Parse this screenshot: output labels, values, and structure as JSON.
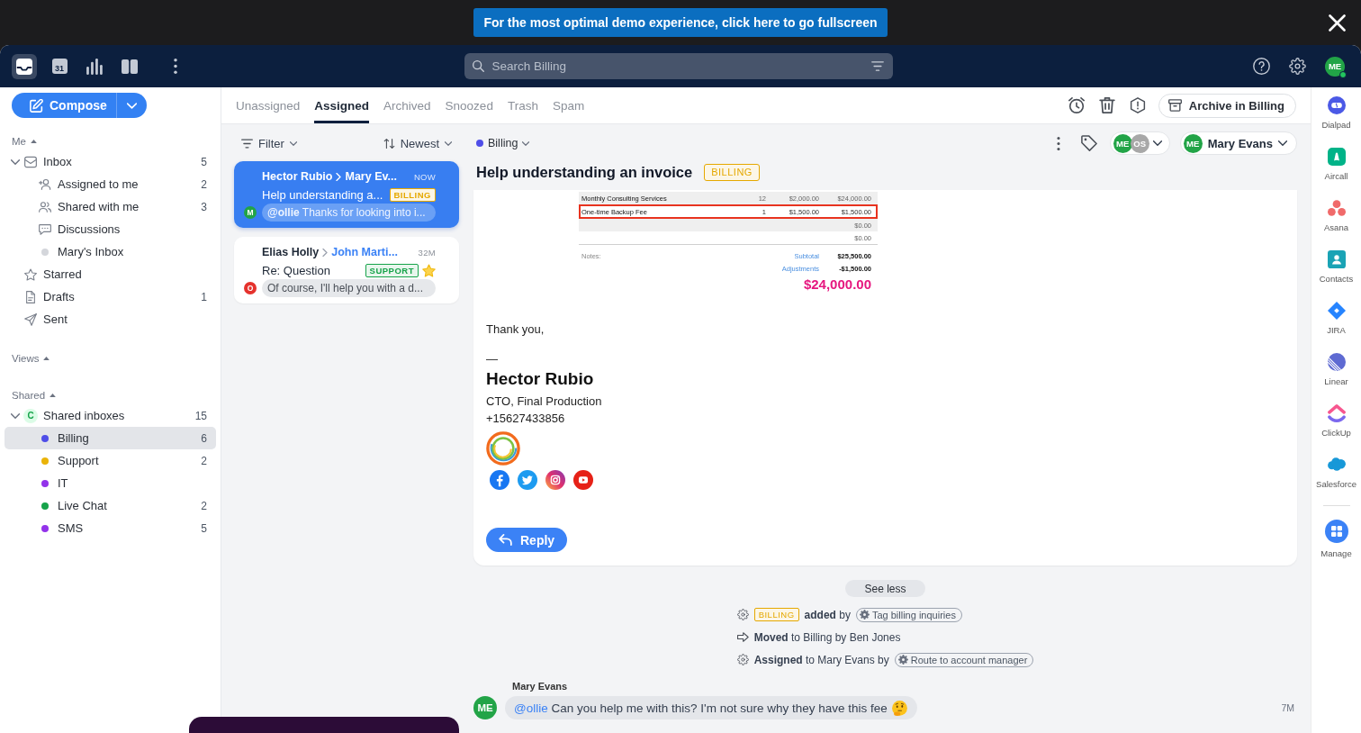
{
  "banner": {
    "text": "For the most optimal demo experience, click here to go fullscreen"
  },
  "top_bar": {
    "nav": [
      {
        "selected": true
      },
      {
        "selected": false,
        "day": "31"
      },
      {
        "selected": false
      },
      {
        "selected": false
      }
    ],
    "search": {
      "placeholder": "Search Billing"
    },
    "user": {
      "initials": "ME",
      "online": true
    }
  },
  "compose": {
    "label": "Compose"
  },
  "sidebar": {
    "sections": [
      {
        "title": "Me",
        "expanded": true,
        "items": [
          {
            "kind": "icon",
            "label": "Inbox",
            "count": "5",
            "expanded": true,
            "selected": false,
            "children": [
              {
                "kind": "icon",
                "label": "Assigned to me",
                "count": "2",
                "selected": false
              },
              {
                "kind": "icon",
                "label": "Shared with me",
                "count": "3",
                "selected": false
              },
              {
                "kind": "icon",
                "label": "Discussions",
                "selected": false
              },
              {
                "kind": "dot",
                "label": "Mary's Inbox",
                "color": "#d4d6db",
                "selected": false
              }
            ]
          },
          {
            "kind": "icon",
            "label": "Starred",
            "selected": false
          },
          {
            "kind": "icon",
            "label": "Drafts",
            "count": "1",
            "selected": false
          },
          {
            "kind": "icon",
            "label": "Sent",
            "selected": false
          }
        ]
      },
      {
        "title": "Views",
        "expanded": true
      },
      {
        "title": "Shared",
        "expanded": true,
        "items": [
          {
            "kind": "badge",
            "label": "Shared inboxes",
            "badge": "C",
            "count": "15",
            "expanded": true,
            "selected": false,
            "children": [
              {
                "kind": "dot",
                "label": "Billing",
                "color": "#4f4ee8",
                "count": "6",
                "selected": true
              },
              {
                "kind": "dot",
                "label": "Support",
                "color": "#eab308",
                "count": "2",
                "selected": false
              },
              {
                "kind": "dot",
                "label": "IT",
                "color": "#9333ea",
                "selected": false
              },
              {
                "kind": "dot",
                "label": "Live Chat",
                "color": "#16a34a",
                "count": "2",
                "selected": false
              },
              {
                "kind": "dot",
                "label": "SMS",
                "color": "#9333ea",
                "count": "5",
                "selected": false
              }
            ]
          }
        ]
      }
    ]
  },
  "tabs": [
    {
      "label": "Unassigned",
      "selected": false
    },
    {
      "label": "Assigned",
      "selected": true
    },
    {
      "label": "Archived",
      "selected": false
    },
    {
      "label": "Snoozed",
      "selected": false
    },
    {
      "label": "Trash",
      "selected": false
    },
    {
      "label": "Spam",
      "selected": false
    }
  ],
  "toolbar": {
    "archive_label": "Archive in Billing"
  },
  "list_toolbar": {
    "filter": "Filter",
    "sort": "Newest"
  },
  "conversations": [
    {
      "from": "Hector Rubio",
      "to": "Mary Ev...",
      "time": "NOW",
      "subject": "Help understanding a...",
      "tag": {
        "label": "BILLING",
        "color": "#e5a800"
      },
      "avatar": {
        "initials": "M",
        "color": "#22a447"
      },
      "preview": "**@ollie** Thanks for looking into i...",
      "selected": true,
      "starred": false
    },
    {
      "from": "Elias Holly",
      "to": "John Marti...",
      "time": "32M",
      "subject": "Re: Question",
      "tag": {
        "label": "SUPPORT",
        "color": "#16a34a"
      },
      "avatar": {
        "initials": "O",
        "color": "#e5322d"
      },
      "preview": "Of course, I'll help you with a d...",
      "selected": false,
      "starred": true
    }
  ],
  "conversation": {
    "inbox": {
      "label": "Billing",
      "color": "#4f4ee8"
    },
    "participants": [
      {
        "initials": "ME",
        "color": "#22a447"
      },
      {
        "initials": "OS",
        "color": "#a8a8a8"
      }
    ],
    "assignee": {
      "initials": "ME",
      "name": "Mary Evans"
    },
    "title": "Help understanding an invoice",
    "tag": {
      "label": "BILLING",
      "color": "#e5a800"
    },
    "invoice": {
      "rows": [
        {
          "description": "Monthly Consulting Services",
          "quantity": "12",
          "rate": "$2,000.00",
          "amount": "$24,000.00",
          "highlighted": false
        },
        {
          "description": "One-time Backup Fee",
          "quantity": "1",
          "rate": "$1,500.00",
          "amount": "$1,500.00",
          "highlighted": true
        },
        {
          "amount": "$0.00",
          "highlighted": false
        },
        {
          "amount": "$0.00",
          "highlighted": false
        }
      ],
      "notes_label": "Notes:",
      "totals": [
        {
          "label": "Subtotal",
          "value": "$25,500.00"
        },
        {
          "label": "Adjustments",
          "value": "-$1,500.00"
        }
      ],
      "total": "$24,000.00"
    },
    "signature": {
      "closing": "Thank you,",
      "separator": "—",
      "name": "Hector Rubio",
      "role": "CTO, Final Production",
      "phone": "+15627433856"
    },
    "reply_label": "Reply",
    "see_less": "See less",
    "activity": [
      {
        "kind": "rule",
        "tag": {
          "label": "BILLING",
          "color": "#e5a800"
        },
        "text": "**added** by",
        "rule": "Tag billing inquiries"
      },
      {
        "kind": "move",
        "text": "**Moved** to Billing by Ben Jones"
      },
      {
        "kind": "rule",
        "text": "**Assigned** to Mary Evans by",
        "rule": "Route to account manager"
      }
    ],
    "comment": {
      "author": "Mary Evans",
      "initials": "ME",
      "mention": "@ollie",
      "text": "Can you help me with this? I'm not sure why they have this fee",
      "time": "7M"
    }
  },
  "apps": [
    {
      "label": "Dialpad"
    },
    {
      "label": "Aircall"
    },
    {
      "label": "Asana"
    },
    {
      "label": "Contacts"
    },
    {
      "label": "JIRA"
    },
    {
      "label": "Linear"
    },
    {
      "label": "ClickUp"
    },
    {
      "label": "Salesforce"
    }
  ],
  "manage": {
    "label": "Manage"
  }
}
